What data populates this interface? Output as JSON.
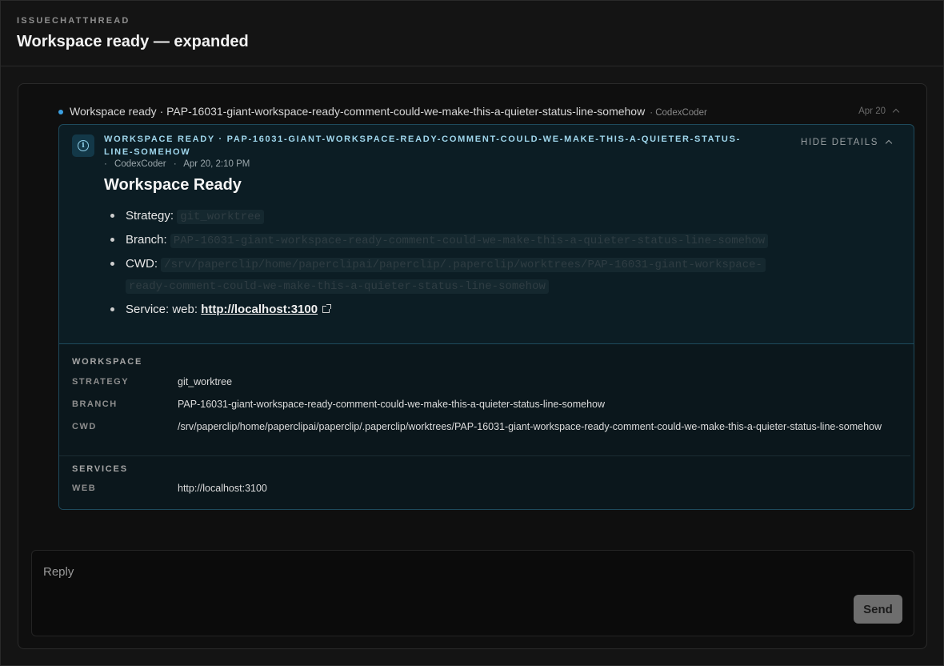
{
  "header": {
    "eyebrow": "ISSUECHATTHREAD",
    "title": "Workspace ready — expanded"
  },
  "status_line": {
    "text": "Workspace ready · PAP-16031-giant-workspace-ready-comment-could-we-make-this-a-quieter-status-line-somehow",
    "author": "· CodexCoder",
    "date": "Apr 20"
  },
  "card": {
    "icon": "info-icon",
    "heading": "Workspace ready · PAP-16031-giant-workspace-ready-comment-could-we-make-this-a-quieter-status-line-somehow",
    "meta_sep": "·",
    "author": "CodexCoder",
    "meta_sep2": "·",
    "timestamp": "Apr 20, 2:10 PM",
    "hide_label": "HIDE DETAILS",
    "title": "Workspace Ready",
    "bullets": {
      "strategy_label": "Strategy:",
      "strategy_value": "git_worktree",
      "branch_label": "Branch:",
      "branch_value": "PAP-16031-giant-workspace-ready-comment-could-we-make-this-a-quieter-status-line-somehow",
      "cwd_label": "CWD:",
      "cwd_value": "/srv/paperclip/home/paperclipai/paperclip/.paperclip/worktrees/PAP-16031-giant-workspace-ready-comment-could-we-make-this-a-quieter-status-line-somehow",
      "service_label": "Service: web:",
      "service_link": "http://localhost:3100"
    },
    "details": {
      "workspace_heading": "WORKSPACE",
      "strategy_key": "STRATEGY",
      "strategy_value": "git_worktree",
      "branch_key": "BRANCH",
      "branch_value": "PAP-16031-giant-workspace-ready-comment-could-we-make-this-a-quieter-status-line-somehow",
      "cwd_key": "CWD",
      "cwd_value": "/srv/paperclip/home/paperclipai/paperclip/.paperclip/worktrees/PAP-16031-giant-workspace-ready-comment-could-we-make-this-a-quieter-status-line-somehow",
      "services_heading": "SERVICES",
      "web_key": "WEB",
      "web_value": "http://localhost:3100"
    }
  },
  "reply": {
    "placeholder": "Reply",
    "send_label": "Send"
  },
  "colors": {
    "accent_dot": "#3b9fe0",
    "card_border": "#1e4a5c",
    "card_heading": "#9fd6ec"
  }
}
